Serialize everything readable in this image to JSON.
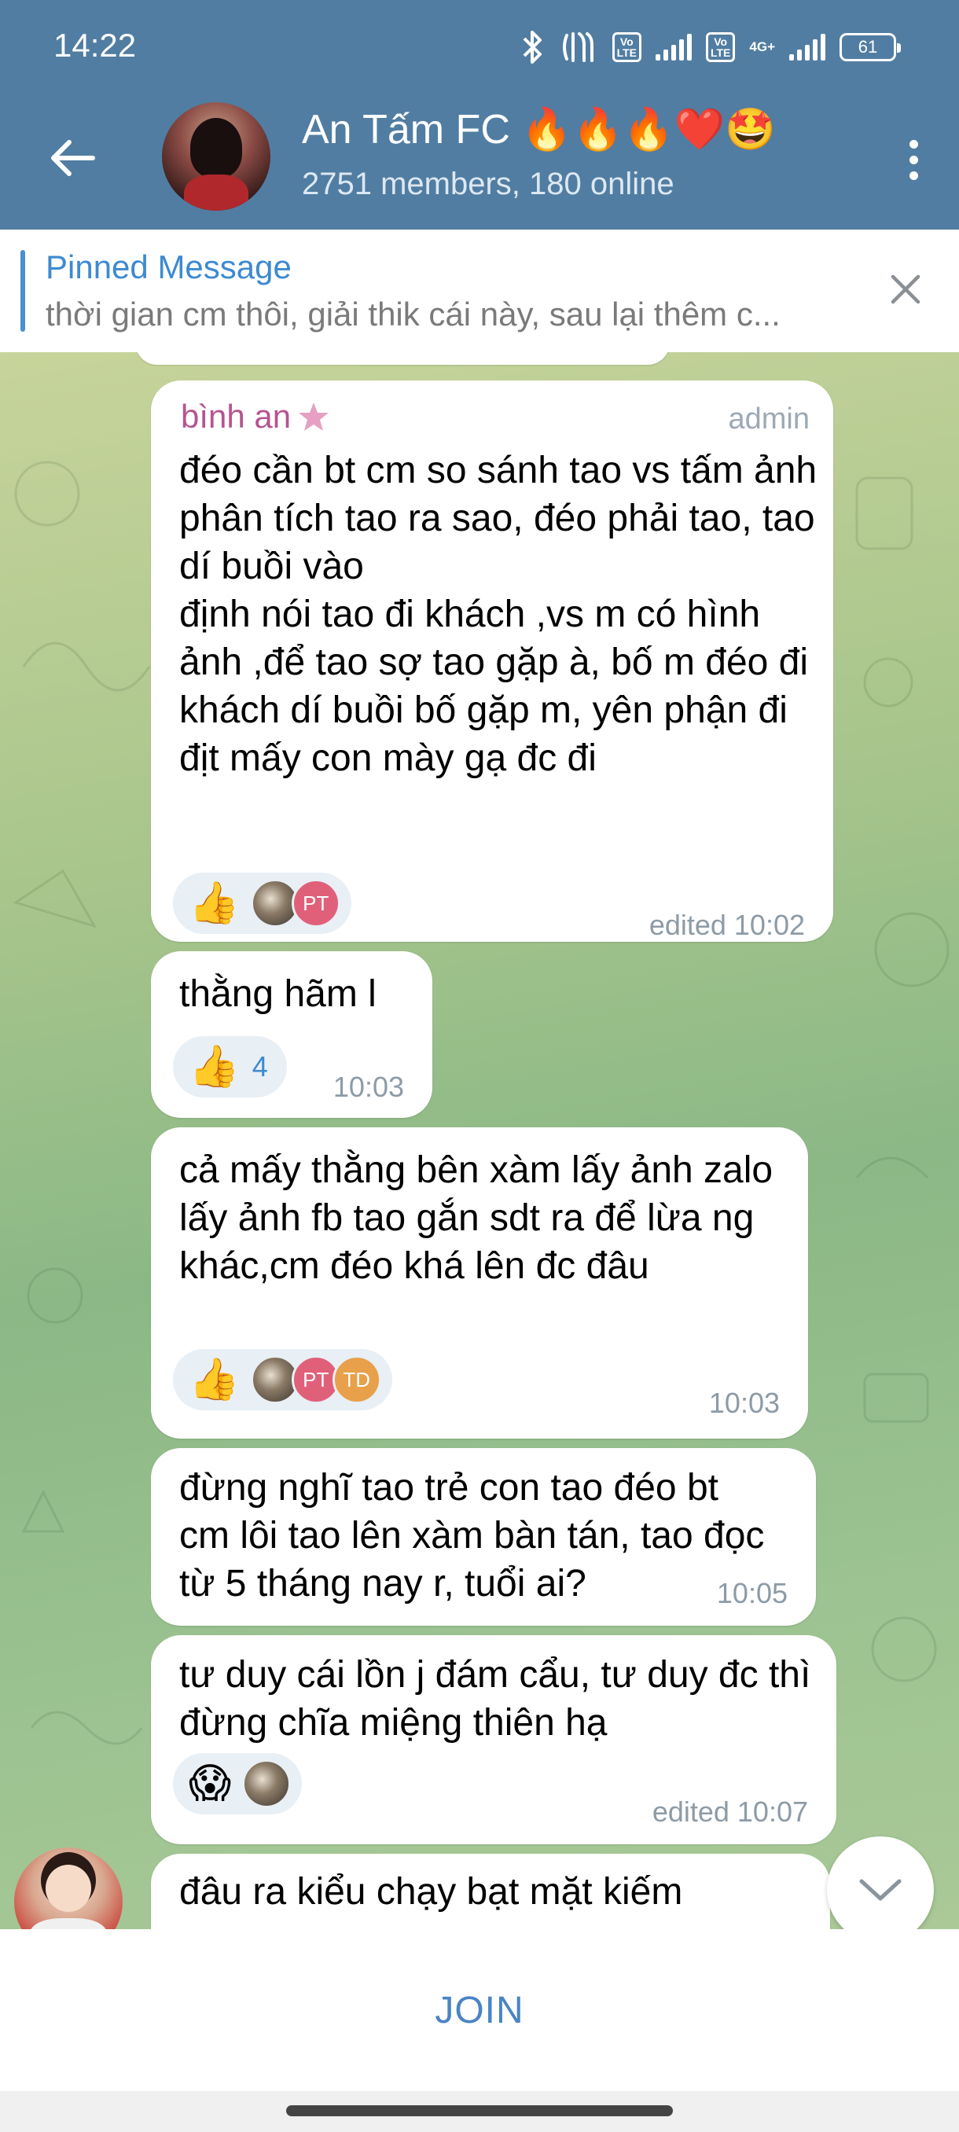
{
  "status_bar": {
    "time": "14:22",
    "battery": "61",
    "volte1": "Vo\nLTE",
    "volte2": "Vo\nLTE",
    "network": "4G+"
  },
  "header": {
    "title": "An Tấm FC 🔥🔥🔥❤️🤩",
    "subtitle": "2751 members, 180 online"
  },
  "pinned": {
    "title": "Pinned Message",
    "text": "thời gian cm thôi, giải thik cái này, sau lại thêm c..."
  },
  "messages": [
    {
      "sender": "bình an",
      "role": "admin",
      "text": "đéo cần bt cm so sánh tao vs tấm ảnh\nphân tích tao ra sao, đéo phải tao, tao dí buồi vào\nđịnh nói tao đi khách ,vs m có hình ảnh ,để tao sợ tao gặp à, bố m đéo đi khách dí buồi bố gặp m, yên phận đi địt mấy con mày gạ đc đi",
      "time": "edited 10:02",
      "reactions": {
        "emoji": "👍",
        "avatars": [
          "photo",
          "PT"
        ]
      }
    },
    {
      "text": "thằng hãm l",
      "time": "10:03",
      "reactions": {
        "emoji": "👍",
        "count": "4"
      }
    },
    {
      "text": "cả mấy thằng bên xàm lấy ảnh zalo lấy  ảnh fb tao gắn sdt ra để lừa ng khác,cm đéo khá lên đc đâu",
      "time": "10:03",
      "reactions": {
        "emoji": "👍",
        "avatars": [
          "photo",
          "PT",
          "TD"
        ]
      }
    },
    {
      "text": "đừng nghĩ tao trẻ con tao đéo bt cm lôi tao lên xàm bàn tán, tao đọc từ 5 tháng nay r, tuổi ai?",
      "time": "10:05"
    },
    {
      "text": "tư duy cái lồn j đám cẩu, tư duy đc thì đừng chĩa miệng thiên hạ",
      "time": "edited 10:07",
      "reactions": {
        "emoji": "😱",
        "avatars": [
          "photo"
        ]
      }
    },
    {
      "text": "đâu ra kiểu chạy bạt mặt kiếm"
    }
  ],
  "bottom": {
    "join_label": "JOIN"
  },
  "colors": {
    "header": "#517da2",
    "accent": "#3d8ad0",
    "sender": "#b6548f"
  }
}
